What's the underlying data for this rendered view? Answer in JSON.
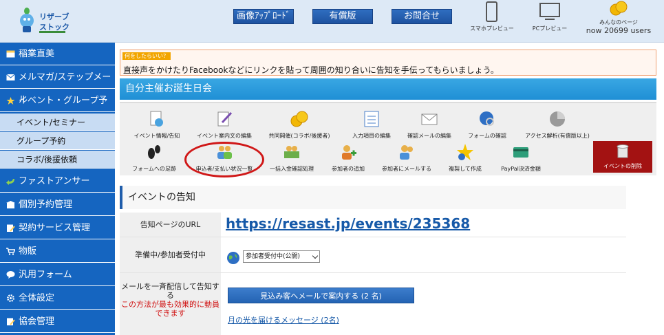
{
  "header": {
    "logo_line1": "リザーブ",
    "logo_line2": "ストック",
    "buttons": [
      "画像ｱｯﾌﾟﾛｰﾄﾞ",
      "有償版",
      "お問合せ"
    ],
    "smartphone_preview": "スマホプレビュー",
    "pc_preview": "PCプレビュー",
    "mypage_label": "みんなのページ",
    "users_count": "now 20699 users"
  },
  "sidebar": {
    "items": [
      {
        "label": "稲業直美",
        "icon": "window-icon"
      },
      {
        "label": "メルマガ/ステップメール",
        "icon": "mail-icon"
      },
      {
        "label": "イベント・グループ予約",
        "icon": "star-icon"
      },
      {
        "label": "ファストアンサー",
        "icon": "arrow-icon"
      },
      {
        "label": "個別予約管理",
        "icon": "building-icon"
      },
      {
        "label": "契約サービス管理",
        "icon": "contract-icon"
      },
      {
        "label": "物販",
        "icon": "cart-icon"
      },
      {
        "label": "汎用フォーム",
        "icon": "bubble-icon"
      },
      {
        "label": "全体設定",
        "icon": "gear-icon"
      },
      {
        "label": "協会管理",
        "icon": "document-icon"
      }
    ],
    "subitems": [
      "イベント/セミナー",
      "グループ予約",
      "コラボ/後援依頼"
    ]
  },
  "notice": {
    "tag": "何をしたらいい？",
    "text": "直接声をかけたりFacebookなどにリンクを貼って周囲の知り合いに告知を手伝ってもらいましょう。"
  },
  "title": "自分主催お誕生日会",
  "toolbar": {
    "row1": [
      "イベント情報/告知",
      "イベント案内文の編集",
      "共同開催(コラボ/後援者)",
      "入力項目の編集",
      "確認メールの編集",
      "フォームの確認",
      "アクセス解析(有償版以上)"
    ],
    "row2": [
      "フォームへの足跡",
      "申込者/支払い状況一覧",
      "一括入金確認処理",
      "参加者の追加",
      "参加者にメールする",
      "複製して作成",
      "PayPal決済金額"
    ],
    "delete_label": "イベントの削除"
  },
  "section": {
    "heading": "イベントの告知",
    "url_label": "告知ページのURL",
    "url": "https://resast.jp/events/235368",
    "status_label": "準備中/参加者受付中",
    "status_value": "参加者受付中(公開)",
    "mail_label": "メールを一斉配信して告知する",
    "mail_note": "この方法が最も効果的に動員できます",
    "mail_button": "見込み客へメールで案内する (2 名)",
    "moon_link": "月の光を届けるメッセージ (2名)"
  },
  "colors": {
    "sidebar": "#1565c0",
    "title_bar": "#1f8fd5",
    "delete": "#a31212",
    "highlight_circle": "#d01818"
  }
}
